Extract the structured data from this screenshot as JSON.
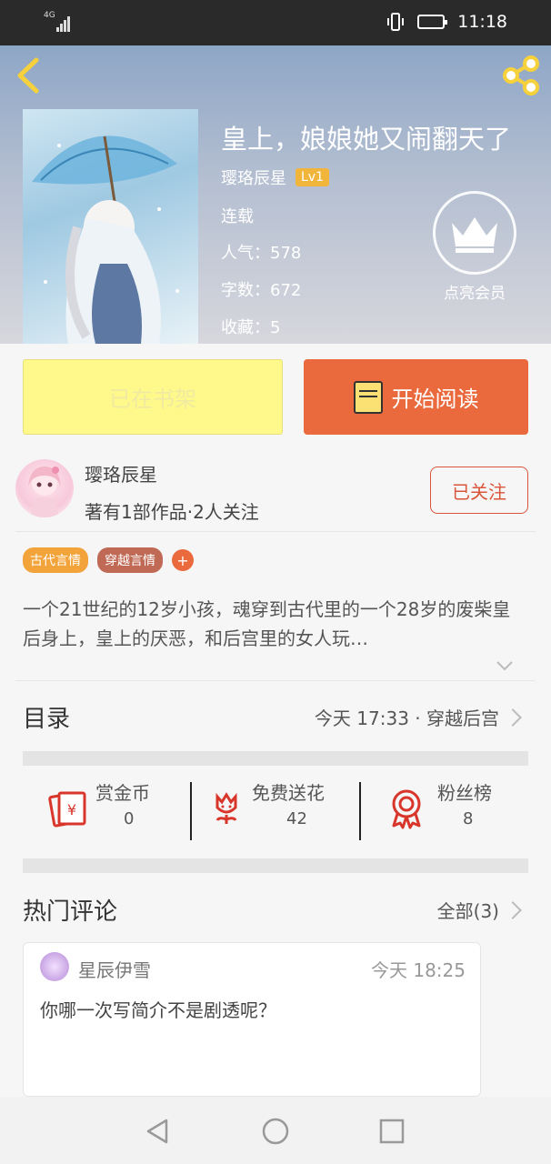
{
  "status_bar": {
    "signal_text": "4G",
    "time": "11:18"
  },
  "book": {
    "title": "皇上，娘娘她又闹翻天了",
    "author": "璎珞辰星",
    "level": "Lv1",
    "status": "连载",
    "popularity": "人气：578",
    "word_count": "字数：672",
    "favorites": "收藏：5",
    "vip_label": "点亮会员"
  },
  "buttons": {
    "bookshelf": "已在书架",
    "start_reading": "开始阅读"
  },
  "author_card": {
    "name": "璎珞辰星",
    "info": "著有1部作品·2人关注",
    "follow": "已关注"
  },
  "tags": [
    {
      "label": "古代言情",
      "color": "#f2a33a"
    },
    {
      "label": "穿越言情",
      "color": "#c06a55"
    }
  ],
  "tag_add": "+",
  "description": "一个21世纪的12岁小孩，魂穿到古代里的一个28岁的废柴皇后身上，皇上的厌恶，和后宫里的女人玩…",
  "catalog": {
    "title": "目录",
    "latest": "今天 17:33 · 穿越后宫"
  },
  "actions": [
    {
      "label": "赏金币",
      "count": "0",
      "icon": "red-envelope-icon"
    },
    {
      "label": "免费送花",
      "count": "42",
      "icon": "flower-icon"
    },
    {
      "label": "粉丝榜",
      "count": "8",
      "icon": "medal-icon"
    }
  ],
  "comments": {
    "title": "热门评论",
    "all": "全部(3)",
    "items": [
      {
        "user": "星辰伊雪",
        "time": "今天 18:25",
        "text": "你哪一次写简介不是剧透呢？"
      }
    ]
  },
  "colors": {
    "accent": "#ea6a3d",
    "follow": "#d9563a",
    "bookshelf": "#fff98c"
  }
}
